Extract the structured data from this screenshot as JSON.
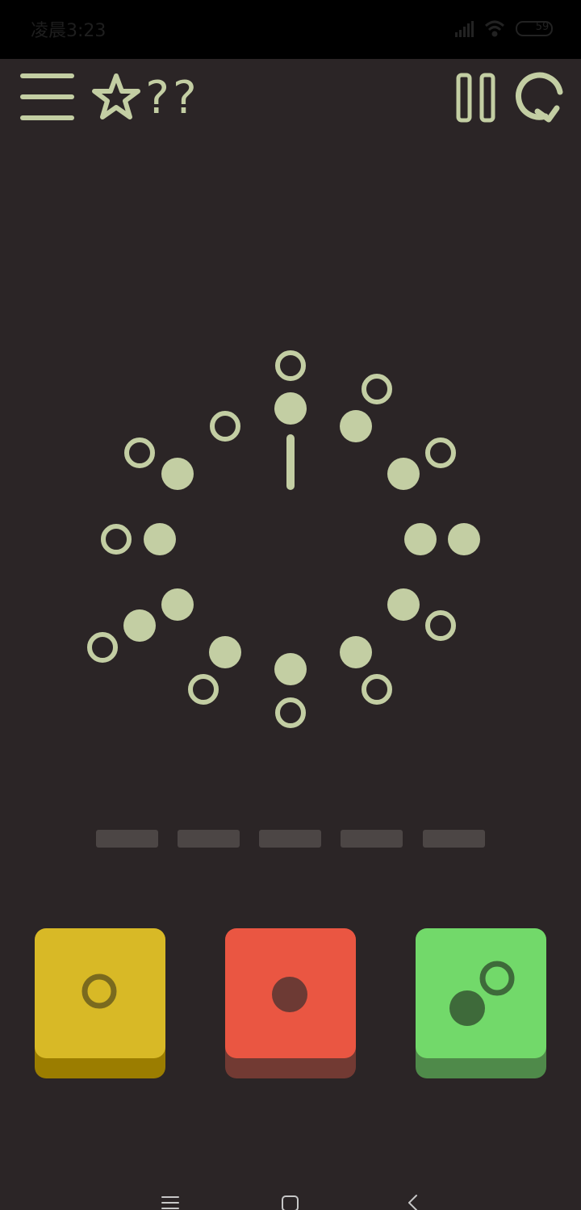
{
  "status_bar": {
    "time": "凌晨3:23",
    "battery": "59",
    "icons": [
      "signal-icon",
      "wifi-icon",
      "battery-icon"
    ]
  },
  "toolbar": {
    "menu_icon": "menu-icon",
    "star_icon": "star-icon",
    "level_text": "??",
    "pause_icon": "pause-icon",
    "restart_icon": "restart-icon"
  },
  "puzzle": {
    "pattern_count": 12,
    "progress_slots": 5,
    "progress_filled": 0
  },
  "choices": [
    {
      "name": "yellow-tile",
      "color": "#d8b926",
      "shadow": "#9b7d00",
      "symbol": "hollow-circle"
    },
    {
      "name": "red-tile",
      "color": "#ea5642",
      "shadow": "#723a33",
      "symbol": "filled-circle"
    },
    {
      "name": "green-tile",
      "color": "#72d96a",
      "shadow": "#4f8a4a",
      "symbol": "filled-and-hollow-circle"
    }
  ],
  "colors": {
    "background": "#2b2526",
    "glyph": "#c3cea3",
    "progress_empty": "#4c4645"
  },
  "nav_bar": {
    "icons": [
      "menu-nav-icon",
      "home-nav-icon",
      "back-nav-icon"
    ]
  }
}
